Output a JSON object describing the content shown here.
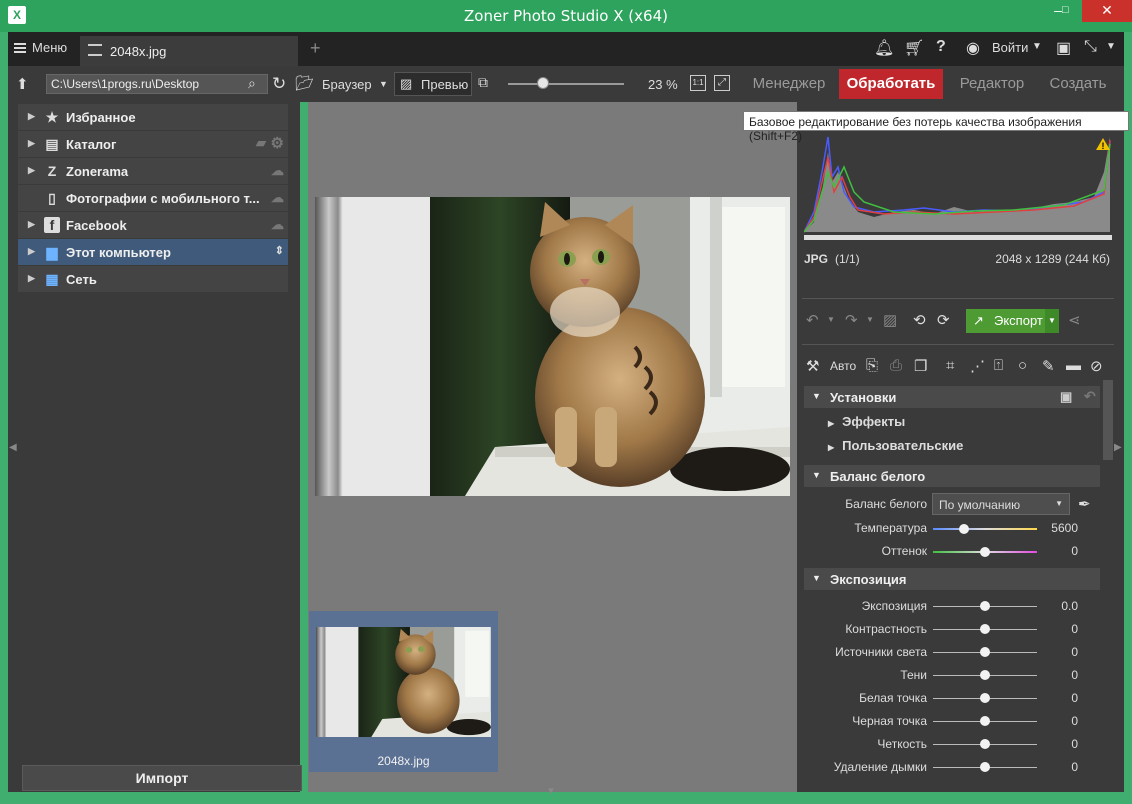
{
  "window": {
    "title": "Zoner Photo Studio X (x64)",
    "min": "–",
    "max": "☐",
    "close": "✕"
  },
  "tabbar": {
    "menu_label": "Меню",
    "file_tab": "2048x.jpg",
    "new_tab": "+",
    "login_label": "Войти"
  },
  "toolbar": {
    "path": "C:\\Users\\1progs.ru\\Desktop",
    "browser_label": "Браузер",
    "preview_label": "Превью",
    "zoom_value": "23 %",
    "zoom_level_fraction": 0.23,
    "fit_1to1": "1:1"
  },
  "modes": [
    {
      "label": "Менеджер"
    },
    {
      "label": "Обработать"
    },
    {
      "label": "Редактор"
    },
    {
      "label": "Создать"
    }
  ],
  "tooltip": "Базовое редактирование без потерь качества изображения (Shift+F2)",
  "nav": [
    {
      "label": "Избранное",
      "icon": "star-icon"
    },
    {
      "label": "Каталог",
      "icon": "catalog-icon"
    },
    {
      "label": "Zonerama",
      "icon": "zonerama-icon"
    },
    {
      "label": "Фотографии с мобильного т...",
      "icon": "phone-icon"
    },
    {
      "label": "Facebook",
      "icon": "facebook-icon"
    },
    {
      "label": "Этот компьютер",
      "icon": "computer-icon"
    },
    {
      "label": "Сеть",
      "icon": "network-icon"
    }
  ],
  "import_label": "Импорт",
  "thumbnail": {
    "label": "2048x.jpg"
  },
  "info": {
    "format": "JPG",
    "count": "(1/1)",
    "dimensions": "2048 x 1289 (244 Кб)"
  },
  "actions": {
    "export_label": "Экспорт",
    "auto_label": "Авто"
  },
  "sections": {
    "settings": "Установки",
    "effects": "Эффекты",
    "custom": "Пользовательские",
    "white_balance": "Баланс белого",
    "exposure_section": "Экспозиция"
  },
  "white_balance": {
    "label": "Баланс белого",
    "value": "По умолчанию",
    "temperature": {
      "label": "Температура",
      "value": "5600",
      "pos": 0.3
    },
    "tint": {
      "label": "Оттенок",
      "value": "0",
      "pos": 0.5
    }
  },
  "exposure": [
    {
      "label": "Экспозиция",
      "value": "0.0",
      "pos": 0.5
    },
    {
      "label": "Контрастность",
      "value": "0",
      "pos": 0.5
    },
    {
      "label": "Источники света",
      "value": "0",
      "pos": 0.5
    },
    {
      "label": "Тени",
      "value": "0",
      "pos": 0.5
    },
    {
      "label": "Белая точка",
      "value": "0",
      "pos": 0.5
    },
    {
      "label": "Черная точка",
      "value": "0",
      "pos": 0.5
    },
    {
      "label": "Четкость",
      "value": "0",
      "pos": 0.5
    },
    {
      "label": "Удаление дымки",
      "value": "0",
      "pos": 0.5
    }
  ],
  "colors": {
    "accent": "#c0272d",
    "window": "#2ea35d",
    "selected": "#3f5a7a",
    "export": "#4e9b34"
  }
}
